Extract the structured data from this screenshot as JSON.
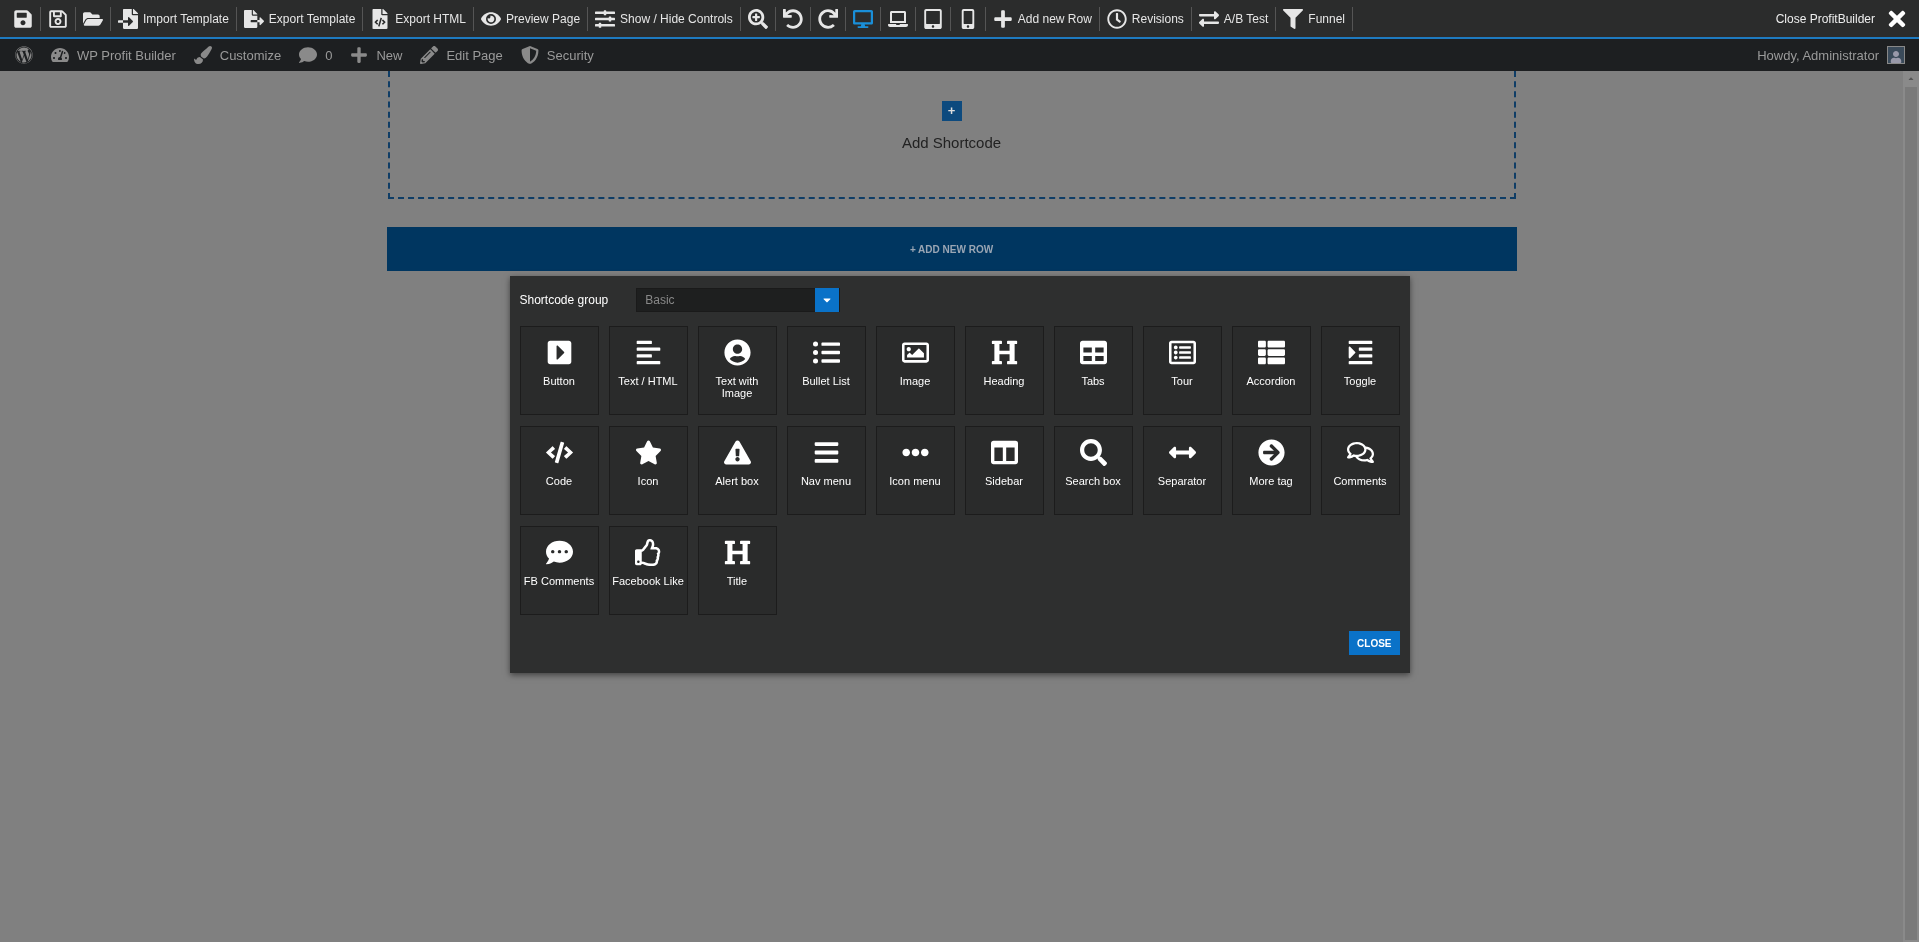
{
  "toolbar": {
    "items": [
      {
        "kind": "save",
        "selected": false
      },
      {
        "kind": "saveall",
        "selected": false
      },
      {
        "kind": "open",
        "selected": false
      },
      {
        "kind": "import",
        "label": "Import Template",
        "selected": false
      },
      {
        "kind": "export",
        "label": "Export Template",
        "selected": false
      },
      {
        "kind": "html",
        "label": "Export HTML",
        "selected": false
      },
      {
        "kind": "preview",
        "label": "Preview Page",
        "selected": false
      },
      {
        "kind": "controls",
        "label": "Show / Hide Controls",
        "selected": false
      },
      {
        "kind": "zoom",
        "selected": false
      },
      {
        "kind": "undo",
        "selected": false
      },
      {
        "kind": "redo",
        "selected": false
      },
      {
        "kind": "desktop",
        "selected": true
      },
      {
        "kind": "laptop",
        "selected": false
      },
      {
        "kind": "tablet",
        "selected": false
      },
      {
        "kind": "phone",
        "selected": false
      },
      {
        "kind": "addrow",
        "label": "Add new Row",
        "selected": false
      },
      {
        "kind": "revisions",
        "label": "Revisions",
        "selected": false
      },
      {
        "kind": "abtest",
        "label": "A/B Test",
        "selected": false
      },
      {
        "kind": "funnel",
        "label": "Funnel",
        "selected": false
      }
    ],
    "close_label": "Close ProfitBuilder"
  },
  "admin_bar": {
    "items": [
      {
        "kind": "wp"
      },
      {
        "kind": "dashboard",
        "label": "WP Profit Builder"
      },
      {
        "kind": "customize",
        "label": "Customize"
      },
      {
        "kind": "comments",
        "label": "0"
      },
      {
        "kind": "new",
        "label": "New"
      },
      {
        "kind": "edit",
        "label": "Edit Page"
      },
      {
        "kind": "security",
        "label": "Security"
      }
    ],
    "greeting": "Howdy, Administrator"
  },
  "canvas": {
    "add_shortcode_icon": "+",
    "add_shortcode": "Add Shortcode",
    "add_row": "+ ADD NEW ROW"
  },
  "dialog": {
    "group_label": "Shortcode group",
    "group_value": "Basic",
    "tiles": [
      {
        "kind": "button",
        "label": "Button"
      },
      {
        "kind": "text",
        "label": "Text / HTML"
      },
      {
        "kind": "textimage",
        "label": "Text with Image"
      },
      {
        "kind": "bullets",
        "label": "Bullet List"
      },
      {
        "kind": "image",
        "label": "Image"
      },
      {
        "kind": "heading",
        "label": "Heading"
      },
      {
        "kind": "tabs",
        "label": "Tabs"
      },
      {
        "kind": "tour",
        "label": "Tour"
      },
      {
        "kind": "accordion",
        "label": "Accordion"
      },
      {
        "kind": "toggle",
        "label": "Toggle"
      },
      {
        "kind": "code",
        "label": "Code"
      },
      {
        "kind": "icon",
        "label": "Icon"
      },
      {
        "kind": "alert",
        "label": "Alert box"
      },
      {
        "kind": "nav",
        "label": "Nav menu"
      },
      {
        "kind": "iconmenu",
        "label": "Icon menu"
      },
      {
        "kind": "sidebar",
        "label": "Sidebar"
      },
      {
        "kind": "search",
        "label": "Search box"
      },
      {
        "kind": "separator",
        "label": "Separator"
      },
      {
        "kind": "more",
        "label": "More tag"
      },
      {
        "kind": "comments",
        "label": "Comments"
      },
      {
        "kind": "fbcomments",
        "label": "FB Comments"
      },
      {
        "kind": "fblike",
        "label": "Facebook Like"
      },
      {
        "kind": "title",
        "label": "Title"
      }
    ],
    "close": "CLOSE"
  }
}
